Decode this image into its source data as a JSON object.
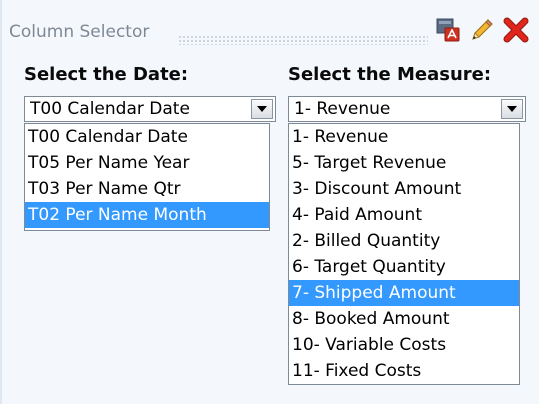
{
  "panel": {
    "title": "Column Selector",
    "icons": [
      "export-icon",
      "edit-pencil-icon",
      "close-icon"
    ]
  },
  "date": {
    "label": "Select the Date:",
    "selected_value": "T00 Calendar Date",
    "options": [
      {
        "label": "T00 Calendar Date",
        "highlighted": false
      },
      {
        "label": "T05 Per Name Year",
        "highlighted": false
      },
      {
        "label": "T03 Per Name Qtr",
        "highlighted": false
      },
      {
        "label": "T02 Per Name Month",
        "highlighted": true
      }
    ]
  },
  "measure": {
    "label": "Select the Measure:",
    "selected_value": "1- Revenue",
    "options": [
      {
        "label": "1- Revenue",
        "highlighted": false
      },
      {
        "label": "5- Target Revenue",
        "highlighted": false
      },
      {
        "label": "3- Discount Amount",
        "highlighted": false
      },
      {
        "label": "4- Paid Amount",
        "highlighted": false
      },
      {
        "label": "2- Billed Quantity",
        "highlighted": false
      },
      {
        "label": "6- Target Quantity",
        "highlighted": false
      },
      {
        "label": "7- Shipped Amount",
        "highlighted": true
      },
      {
        "label": "8- Booked Amount",
        "highlighted": false
      },
      {
        "label": "10- Variable Costs",
        "highlighted": false
      },
      {
        "label": "11- Fixed Costs",
        "highlighted": false
      }
    ]
  },
  "colors": {
    "highlight": "#3399ff",
    "panel_bg": "#f4f8fc",
    "close_red": "#e0261c"
  }
}
